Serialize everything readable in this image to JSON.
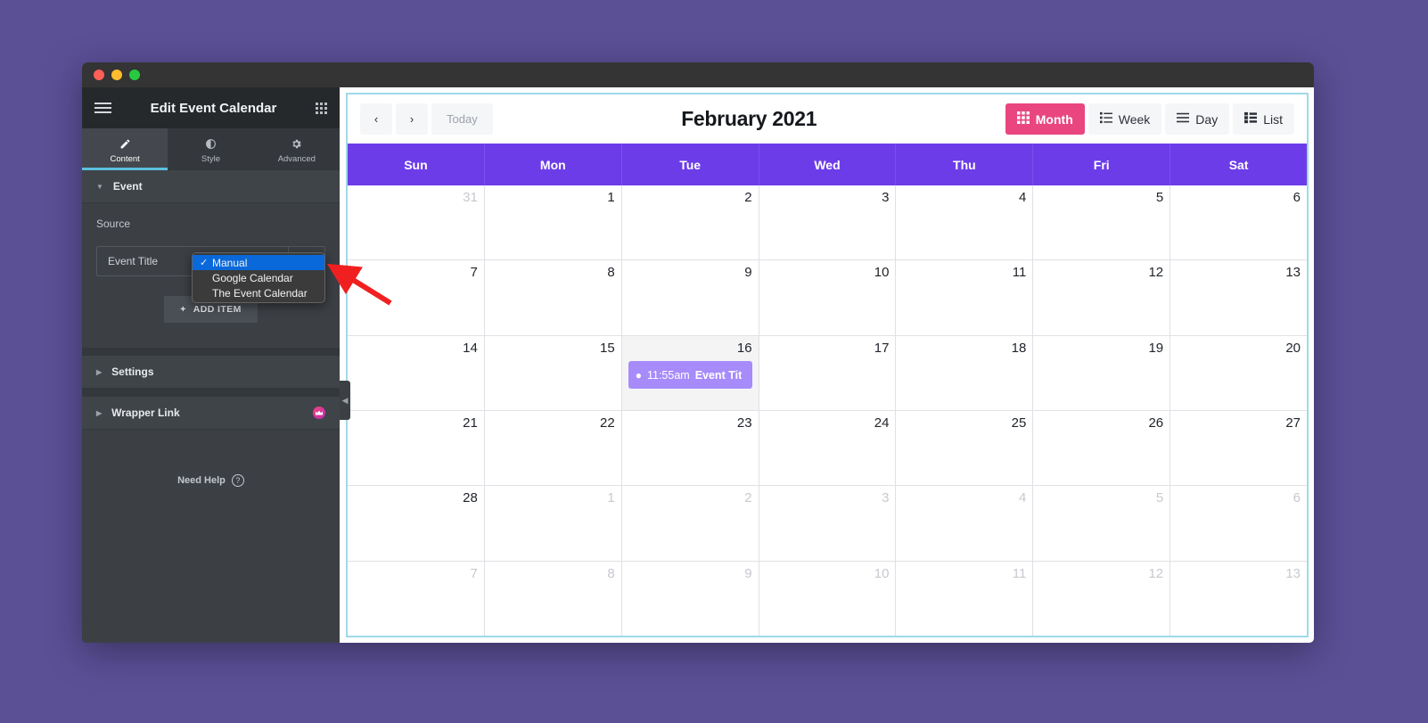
{
  "window": {
    "traffic_lights": [
      "close",
      "minimize",
      "maximize"
    ]
  },
  "panel": {
    "title": "Edit Event Calendar",
    "menu_icon": "hamburger-icon",
    "widgets_icon": "grid-icon",
    "tabs": [
      {
        "label": "Content",
        "icon": "pencil-icon",
        "active": true
      },
      {
        "label": "Style",
        "icon": "contrast-icon",
        "active": false
      },
      {
        "label": "Advanced",
        "icon": "gear-icon",
        "active": false
      }
    ],
    "sections": [
      {
        "label": "Event",
        "expanded": true
      },
      {
        "label": "Settings",
        "expanded": false
      },
      {
        "label": "Wrapper Link",
        "expanded": false,
        "pro": true
      }
    ],
    "source": {
      "label": "Source",
      "value": "Manual",
      "options": [
        "Manual",
        "Google Calendar",
        "The Event Calendar"
      ],
      "selected_index": 0
    },
    "repeater_item": {
      "title": "Event Title",
      "duplicate_icon": "copy-icon"
    },
    "add_item_label": "ADD ITEM",
    "need_help": "Need Help",
    "collapse_handle": "chevron-left-icon"
  },
  "calendar": {
    "prev_label": "‹",
    "next_label": "›",
    "today_label": "Today",
    "title": "February 2021",
    "views": [
      {
        "label": "Month",
        "icon": "grid-view-icon",
        "active": true
      },
      {
        "label": "Week",
        "icon": "list-view-icon",
        "active": false
      },
      {
        "label": "Day",
        "icon": "lines-icon",
        "active": false
      },
      {
        "label": "List",
        "icon": "list-icon",
        "active": false
      }
    ],
    "day_names": [
      "Sun",
      "Mon",
      "Tue",
      "Wed",
      "Thu",
      "Fri",
      "Sat"
    ],
    "weeks": [
      [
        {
          "num": "31",
          "other": true
        },
        {
          "num": "1"
        },
        {
          "num": "2"
        },
        {
          "num": "3"
        },
        {
          "num": "4"
        },
        {
          "num": "5"
        },
        {
          "num": "6"
        }
      ],
      [
        {
          "num": "7"
        },
        {
          "num": "8"
        },
        {
          "num": "9"
        },
        {
          "num": "10"
        },
        {
          "num": "11"
        },
        {
          "num": "12"
        },
        {
          "num": "13"
        }
      ],
      [
        {
          "num": "14"
        },
        {
          "num": "15"
        },
        {
          "num": "16",
          "today": true,
          "event": {
            "time": "11:55am",
            "title": "Event Tit"
          }
        },
        {
          "num": "17"
        },
        {
          "num": "18"
        },
        {
          "num": "19"
        },
        {
          "num": "20"
        }
      ],
      [
        {
          "num": "21"
        },
        {
          "num": "22"
        },
        {
          "num": "23"
        },
        {
          "num": "24"
        },
        {
          "num": "25"
        },
        {
          "num": "26"
        },
        {
          "num": "27"
        }
      ],
      [
        {
          "num": "28"
        },
        {
          "num": "1",
          "other": true
        },
        {
          "num": "2",
          "other": true
        },
        {
          "num": "3",
          "other": true
        },
        {
          "num": "4",
          "other": true
        },
        {
          "num": "5",
          "other": true
        },
        {
          "num": "6",
          "other": true
        }
      ],
      [
        {
          "num": "7",
          "other": true
        },
        {
          "num": "8",
          "other": true
        },
        {
          "num": "9",
          "other": true
        },
        {
          "num": "10",
          "other": true
        },
        {
          "num": "11",
          "other": true
        },
        {
          "num": "12",
          "other": true
        },
        {
          "num": "13",
          "other": true
        }
      ]
    ]
  },
  "annotation": {
    "arrow": "red-arrow-pointing-to-source-dropdown"
  },
  "colors": {
    "page_background": "#5b4f96",
    "panel_background": "#3c4045",
    "accent_blue": "#0a69da",
    "calendar_header_purple": "#6c3ce9",
    "active_view_pink": "#e9467f",
    "event_chip_purple": "#a78bfa",
    "selection_outline": "#9fd9ea",
    "annotation_red": "#f02020"
  }
}
